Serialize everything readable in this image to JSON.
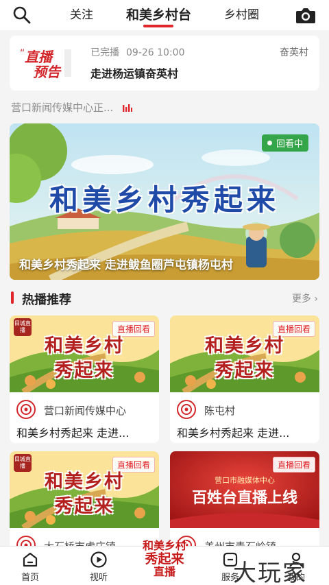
{
  "header": {
    "tabs": [
      {
        "label": "关注"
      },
      {
        "label": "和美乡村台"
      },
      {
        "label": "乡村圈"
      }
    ],
    "active_tab": "和美乡村台",
    "accent_color": "#e0262c"
  },
  "preview_card": {
    "logo_text": "直播预告",
    "status": "已完播",
    "datetime": "09-26 10:00",
    "village": "奋英村",
    "title": "走进杨运镇奋英村"
  },
  "source_line": {
    "text": "营口新闻传媒中心正..."
  },
  "banner": {
    "tag": "回看中",
    "big_text": "和美乡村秀起来",
    "caption": "和美乡村秀起来 走进鲅鱼圈芦屯镇杨屯村"
  },
  "section": {
    "title": "热播推荐",
    "more": "更多"
  },
  "cards": [
    {
      "badge": "直播回看",
      "logo": "目城直播",
      "line1": "和美乡村",
      "line2": "秀起来",
      "author": "营口新闻传媒中心",
      "title": "和美乡村秀起来 走进..."
    },
    {
      "badge": "直播回看",
      "logo": "",
      "line1": "和美乡村",
      "line2": "秀起来",
      "author": "陈屯村",
      "title": "和美乡村秀起来 走进..."
    },
    {
      "badge": "直播回看",
      "logo": "目城直播",
      "line1": "和美乡村",
      "line2": "秀起来",
      "author": "大石桥市虎庄镇",
      "title": ""
    },
    {
      "badge": "直播回看",
      "logo": "",
      "line1": "营口市融媒体中心",
      "line2": "百姓台直播上线",
      "author": "盖州市青石岭镇",
      "title": ""
    }
  ],
  "bottom_nav": {
    "items": [
      {
        "label": "首页",
        "icon": "home-icon"
      },
      {
        "label": "视听",
        "icon": "play-icon"
      },
      {
        "label": "服务",
        "icon": "service-icon"
      },
      {
        "label": "我的",
        "icon": "profile-icon"
      }
    ],
    "center_line1": "和美乡村",
    "center_line2": "秀起来",
    "center_line3": "直播"
  },
  "watermark": "大玩家"
}
